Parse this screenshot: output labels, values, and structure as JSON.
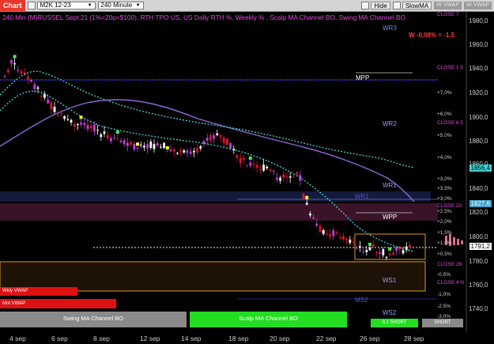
{
  "toolbar": {
    "chart_tab": "Chart",
    "symbol": "M2K 12-23",
    "interval": "240 Minute",
    "hide_label": "Hide",
    "study_name": "SlowMA",
    "indicator_1": "W VWAP",
    "indicator_2": "W VWAP"
  },
  "chart_title": "240 Min (M)RUSSEL Sept 21 (1%=20p=$100), RTH TPO US, US Daily RTH %, Weekly % , Scalp MA Channel BO, Swing MA Channel BO",
  "change_readout": "W -0,08% = -1,5",
  "levels": {
    "wr3": "WR3",
    "mpp": "MPP",
    "wr2": "WR2",
    "wr1": "WR1",
    "wr1b": "WR1",
    "wpp": "WPP",
    "ws1": "WS1",
    "ms2": "MS2",
    "ws2": "WS2",
    "close_7": "CLOSE 7",
    "close_1": "CLOSE 1 5",
    "close_6": "CLOSE 6 5",
    "close_20": "CLOSE 20",
    "close_26": "CLOSE 26",
    "close_4": "CLOSE 4 N"
  },
  "percent_labels": [
    "+7,0%",
    "+6,0%",
    "+5,0%",
    "+4,0%",
    "+3,0%",
    "+3,5%",
    "+3,0%",
    "+2,5%",
    "+2,0%",
    "+1,5%",
    "+1,0%",
    "+0,5%",
    "-0,5%",
    "-1,0%",
    "-2,5%",
    "-3,0%"
  ],
  "price_axis": [
    "1980,0",
    "1960,0",
    "1940,0",
    "1920,0",
    "1900,0",
    "1880,0",
    "1860,0",
    "1840,0",
    "1820,0",
    "1800,0",
    "1780,0",
    "1760,0",
    "1740,0"
  ],
  "price_badges": {
    "cyan": "1856,4",
    "gray": "1827,6",
    "white": "1791,2"
  },
  "dates": [
    "4 sep",
    "6 sep",
    "8 sep",
    "12 sep",
    "14 sep",
    "18 sep",
    "20 sep",
    "22 sep",
    "26 sep",
    "28 sep"
  ],
  "buttons": {
    "wkly_vwap": "Wkly VWAP",
    "mnt_vwap": "Mnt VWAP",
    "swing": "Swing MA Channel BO",
    "scalp": "Scalp MA Channel BO",
    "scalp_small": "0,1 SHORT",
    "swing_small": "SHORT"
  },
  "colors": {
    "magenta": "#e845e0",
    "cyan_ma": "#3fd4d4",
    "slow_ma": "#8a6ad8",
    "bar_red": "#e0102a",
    "bar_magenta": "#c43adb",
    "green_btn": "#22dd22",
    "red_btn": "#dd1111"
  }
}
